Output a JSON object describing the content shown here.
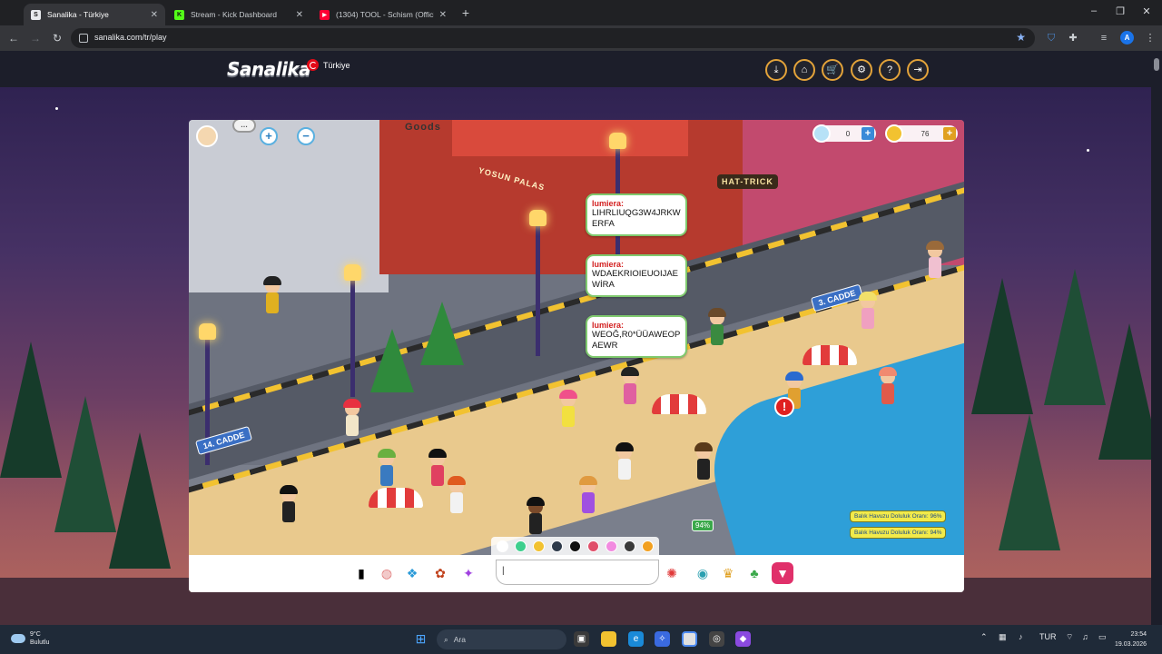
{
  "browser": {
    "tabs": [
      {
        "title": "Sanalika - Türkiye",
        "favicon": "sanalika-favicon",
        "active": true
      },
      {
        "title": "Stream - Kick Dashboard",
        "favicon": "kick-favicon",
        "active": false
      },
      {
        "title": "(1304) TOOL - Schism (Official",
        "favicon": "youtube-favicon",
        "active": false
      }
    ],
    "new_tab": "+",
    "url": "sanalika.com/tr/play",
    "profile_initial": "A"
  },
  "site": {
    "logo": "Sanalika",
    "region": "Türkiye",
    "header_buttons": [
      "download-icon",
      "home-icon",
      "cart-icon",
      "gear-icon",
      "help-icon",
      "logout-icon"
    ]
  },
  "game": {
    "diamonds": "0",
    "coins": "76",
    "street_signs": [
      "14. CADDE",
      "3. CADDE"
    ],
    "shop_signs": [
      "Goods",
      "YOSUN PALAS",
      "HAT-TRICK"
    ],
    "chat": [
      {
        "user": "lumiera:",
        "text": "LIHRLIUQG3W4JRKWERFA"
      },
      {
        "user": "lumiera:",
        "text": "WDAEKRIOIEUOIJAEWİRA"
      },
      {
        "user": "lumiera:",
        "text": "WEOĞ,R0*ÜÜAWEOPAEWR"
      }
    ],
    "fishing_progress": "94%",
    "notices": [
      "Balık Havuzu Doluluk Oranı: 96%",
      "Balık Havuzu Doluluk Oranı: 94%"
    ],
    "palette_colors": [
      "#ffffff",
      "#3ecf8e",
      "#f2c230",
      "#2e3a4a",
      "#111111",
      "#e04f6a",
      "#f28be0",
      "#3a3a3a",
      "#f2a020"
    ],
    "chat_input_value": "|"
  },
  "taskbar": {
    "weather_temp": "9°C",
    "weather_desc": "Bulutlu",
    "search_placeholder": "Ara",
    "lang": "TUR",
    "time": "23:54",
    "date": "19.03.2026"
  }
}
